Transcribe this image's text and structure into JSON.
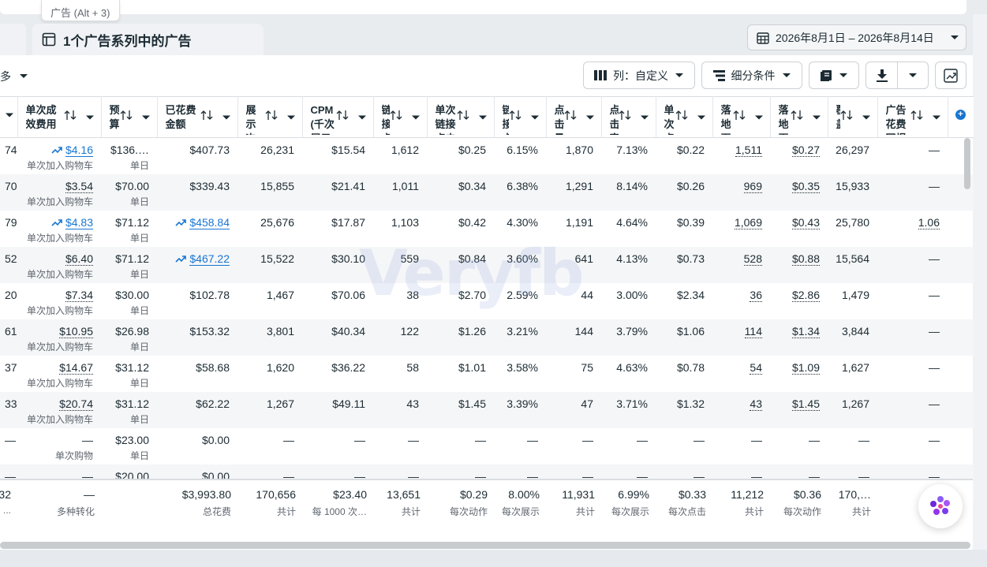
{
  "tooltip": "广告 (Alt + 3)",
  "tab_title": "1个广告系列中的广告",
  "date_range": "2026年8月1日 – 2026年8月14日",
  "truncated_label": "多",
  "toolbar": {
    "columns_label": "列：自定义",
    "breakdown_label": "细分条件"
  },
  "columns": [
    {
      "label": "",
      "w": 22
    },
    {
      "label": "单次成效费用",
      "w": 106
    },
    {
      "label": "预算",
      "w": 71
    },
    {
      "label": "已花费金额",
      "w": 102
    },
    {
      "label": "展示次数",
      "w": 82
    },
    {
      "label": "CPM (千次展示费用)",
      "w": 90
    },
    {
      "label": "链接点击量",
      "w": 68
    },
    {
      "label": "单次链接点击费用",
      "w": 85
    },
    {
      "label": "链接点击率",
      "w": 66
    },
    {
      "label": "点击量",
      "w": 70
    },
    {
      "label": "点击率",
      "w": 69
    },
    {
      "label": "单次点击费用",
      "w": 72
    },
    {
      "label": "落地页浏览量",
      "w": 73
    },
    {
      "label": "落地页浏览费用",
      "w": 73
    },
    {
      "label": "覆盖人数",
      "w": 63
    },
    {
      "label": "广告花费回报",
      "w": 89
    },
    {
      "label": "",
      "w": 33
    }
  ],
  "rows": [
    {
      "c0": "74",
      "cpr": "$4.16",
      "cpr_sub": "单次加入购物车",
      "cpr_trend": true,
      "budget": "$136.…",
      "budget_sub": "单日",
      "spend": "$407.73",
      "spend_trend": false,
      "imp": "26,231",
      "cpm": "$15.54",
      "lc": "1,612",
      "cplc": "$0.25",
      "lctr": "6.15%",
      "clicks": "1,870",
      "ctr": "7.13%",
      "cpc": "$0.22",
      "lpv": "1,511",
      "cplpv": "$0.27",
      "reach": "26,297",
      "roas": "—"
    },
    {
      "c0": "70",
      "cpr": "$3.54",
      "cpr_sub": "单次加入购物车",
      "cpr_trend": false,
      "budget": "$70.00",
      "budget_sub": "单日",
      "spend": "$339.43",
      "spend_trend": false,
      "imp": "15,855",
      "cpm": "$21.41",
      "lc": "1,011",
      "cplc": "$0.34",
      "lctr": "6.38%",
      "clicks": "1,291",
      "ctr": "8.14%",
      "cpc": "$0.26",
      "lpv": "969",
      "cplpv": "$0.35",
      "reach": "15,933",
      "roas": "—"
    },
    {
      "c0": "79",
      "cpr": "$4.83",
      "cpr_sub": "单次加入购物车",
      "cpr_trend": true,
      "budget": "$71.12",
      "budget_sub": "单日",
      "spend": "$458.84",
      "spend_trend": true,
      "imp": "25,676",
      "cpm": "$17.87",
      "lc": "1,103",
      "cplc": "$0.42",
      "lctr": "4.30%",
      "clicks": "1,191",
      "ctr": "4.64%",
      "cpc": "$0.39",
      "lpv": "1,069",
      "cplpv": "$0.43",
      "reach": "25,780",
      "roas": "1.06"
    },
    {
      "c0": "52",
      "cpr": "$6.40",
      "cpr_sub": "单次加入购物车",
      "cpr_trend": false,
      "budget": "$71.12",
      "budget_sub": "单日",
      "spend": "$467.22",
      "spend_trend": true,
      "imp": "15,522",
      "cpm": "$30.10",
      "lc": "559",
      "cplc": "$0.84",
      "lctr": "3.60%",
      "clicks": "641",
      "ctr": "4.13%",
      "cpc": "$0.73",
      "lpv": "528",
      "cplpv": "$0.88",
      "reach": "15,564",
      "roas": "—"
    },
    {
      "c0": "20",
      "cpr": "$7.34",
      "cpr_sub": "单次加入购物车",
      "cpr_trend": false,
      "budget": "$30.00",
      "budget_sub": "单日",
      "spend": "$102.78",
      "spend_trend": false,
      "imp": "1,467",
      "cpm": "$70.06",
      "lc": "38",
      "cplc": "$2.70",
      "lctr": "2.59%",
      "clicks": "44",
      "ctr": "3.00%",
      "cpc": "$2.34",
      "lpv": "36",
      "cplpv": "$2.86",
      "reach": "1,479",
      "roas": "—"
    },
    {
      "c0": "61",
      "cpr": "$10.95",
      "cpr_sub": "单次加入购物车",
      "cpr_trend": false,
      "budget": "$26.98",
      "budget_sub": "单日",
      "spend": "$153.32",
      "spend_trend": false,
      "imp": "3,801",
      "cpm": "$40.34",
      "lc": "122",
      "cplc": "$1.26",
      "lctr": "3.21%",
      "clicks": "144",
      "ctr": "3.79%",
      "cpc": "$1.06",
      "lpv": "114",
      "cplpv": "$1.34",
      "reach": "3,844",
      "roas": "—"
    },
    {
      "c0": "37",
      "cpr": "$14.67",
      "cpr_sub": "单次加入购物车",
      "cpr_trend": false,
      "budget": "$31.12",
      "budget_sub": "单日",
      "spend": "$58.68",
      "spend_trend": false,
      "imp": "1,620",
      "cpm": "$36.22",
      "lc": "58",
      "cplc": "$1.01",
      "lctr": "3.58%",
      "clicks": "75",
      "ctr": "4.63%",
      "cpc": "$0.78",
      "lpv": "54",
      "cplpv": "$1.09",
      "reach": "1,627",
      "roas": "—"
    },
    {
      "c0": "33",
      "cpr": "$20.74",
      "cpr_sub": "单次加入购物车",
      "cpr_trend": false,
      "budget": "$31.12",
      "budget_sub": "单日",
      "spend": "$62.22",
      "spend_trend": false,
      "imp": "1,267",
      "cpm": "$49.11",
      "lc": "43",
      "cplc": "$1.45",
      "lctr": "3.39%",
      "clicks": "47",
      "ctr": "3.71%",
      "cpc": "$1.32",
      "lpv": "43",
      "cplpv": "$1.45",
      "reach": "1,267",
      "roas": "—"
    },
    {
      "c0": "—",
      "cpr": "—",
      "cpr_sub": "单次购物",
      "cpr_trend": false,
      "budget": "$23.00",
      "budget_sub": "单日",
      "spend": "$0.00",
      "spend_trend": false,
      "imp": "—",
      "cpm": "—",
      "lc": "—",
      "cplc": "—",
      "lctr": "—",
      "clicks": "—",
      "ctr": "—",
      "cpc": "—",
      "lpv": "—",
      "cplpv": "—",
      "reach": "—",
      "roas": "—"
    },
    {
      "c0": "—",
      "cpr": "—",
      "cpr_sub": "",
      "cpr_trend": false,
      "budget": "$20.00",
      "budget_sub": "",
      "spend": "$0.00",
      "spend_trend": false,
      "imp": "—",
      "cpm": "—",
      "lc": "—",
      "cplc": "—",
      "lctr": "—",
      "clicks": "—",
      "ctr": "—",
      "cpc": "—",
      "lpv": "—",
      "cplpv": "—",
      "reach": "—",
      "roas": "—"
    }
  ],
  "totals": {
    "c0": "32",
    "c0_sub": "...",
    "cpr": "—",
    "cpr_sub": "多种转化",
    "spend": "$3,993.80",
    "spend_sub": "总花费",
    "imp": "170,656",
    "imp_sub": "共计",
    "cpm": "$23.40",
    "cpm_sub": "每 1000 次…",
    "lc": "13,651",
    "lc_sub": "共计",
    "cplc": "$0.29",
    "cplc_sub": "每次动作",
    "lctr": "8.00%",
    "lctr_sub": "每次展示",
    "clicks": "11,931",
    "clicks_sub": "共计",
    "ctr": "6.99%",
    "ctr_sub": "每次展示",
    "cpc": "$0.33",
    "cpc_sub": "每次点击",
    "lpv": "11,212",
    "lpv_sub": "共计",
    "cplpv": "$0.36",
    "cplpv_sub": "每次动作",
    "reach": "170,…",
    "reach_sub": "共计"
  },
  "watermark": "Veryfb"
}
